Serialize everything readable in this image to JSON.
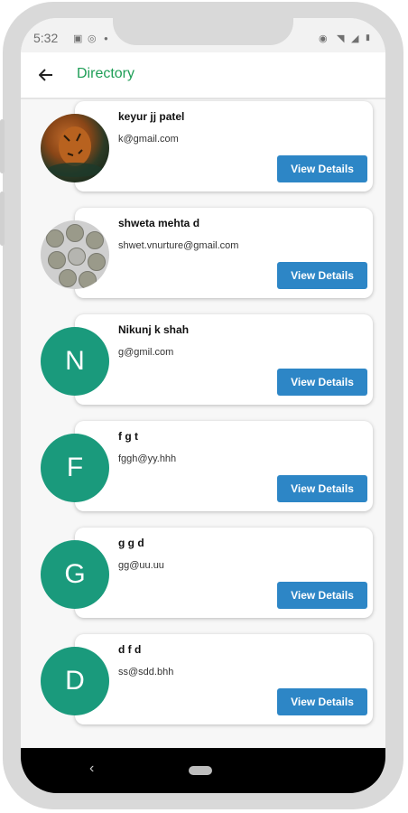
{
  "status_bar": {
    "time": "5:32",
    "right_icons": [
      "eye-icon",
      "wifi-icon",
      "signal-icon",
      "battery-icon"
    ]
  },
  "app_bar": {
    "title": "Directory",
    "back_icon": "arrow-left-icon"
  },
  "colors": {
    "title_green": "#1f9e57",
    "button_blue": "#2d86c6",
    "avatar_teal": "#1a9a7c"
  },
  "contacts": [
    {
      "name": "keyur jj  patel",
      "email": "k@gmail.com",
      "avatar": "photo",
      "avatar_letter": "",
      "button": "View Details"
    },
    {
      "name": "shweta mehta  d",
      "email": "shwet.vnurture@gmail.com",
      "avatar": "photo",
      "avatar_letter": "",
      "button": "View Details"
    },
    {
      "name": "Nikunj k  shah",
      "email": "g@gmil.com",
      "avatar": "letter",
      "avatar_letter": "N",
      "button": "View Details"
    },
    {
      "name": "f  g  t",
      "email": "fggh@yy.hhh",
      "avatar": "letter",
      "avatar_letter": "F",
      "button": "View Details"
    },
    {
      "name": "g  g  d",
      "email": "gg@uu.uu",
      "avatar": "letter",
      "avatar_letter": "G",
      "button": "View Details"
    },
    {
      "name": "d  f  d",
      "email": "ss@sdd.bhh",
      "avatar": "letter",
      "avatar_letter": "D",
      "button": "View Details"
    }
  ],
  "nav_bar": {
    "back_icon": "nav-back-icon",
    "home_icon": "home-pill-icon"
  }
}
